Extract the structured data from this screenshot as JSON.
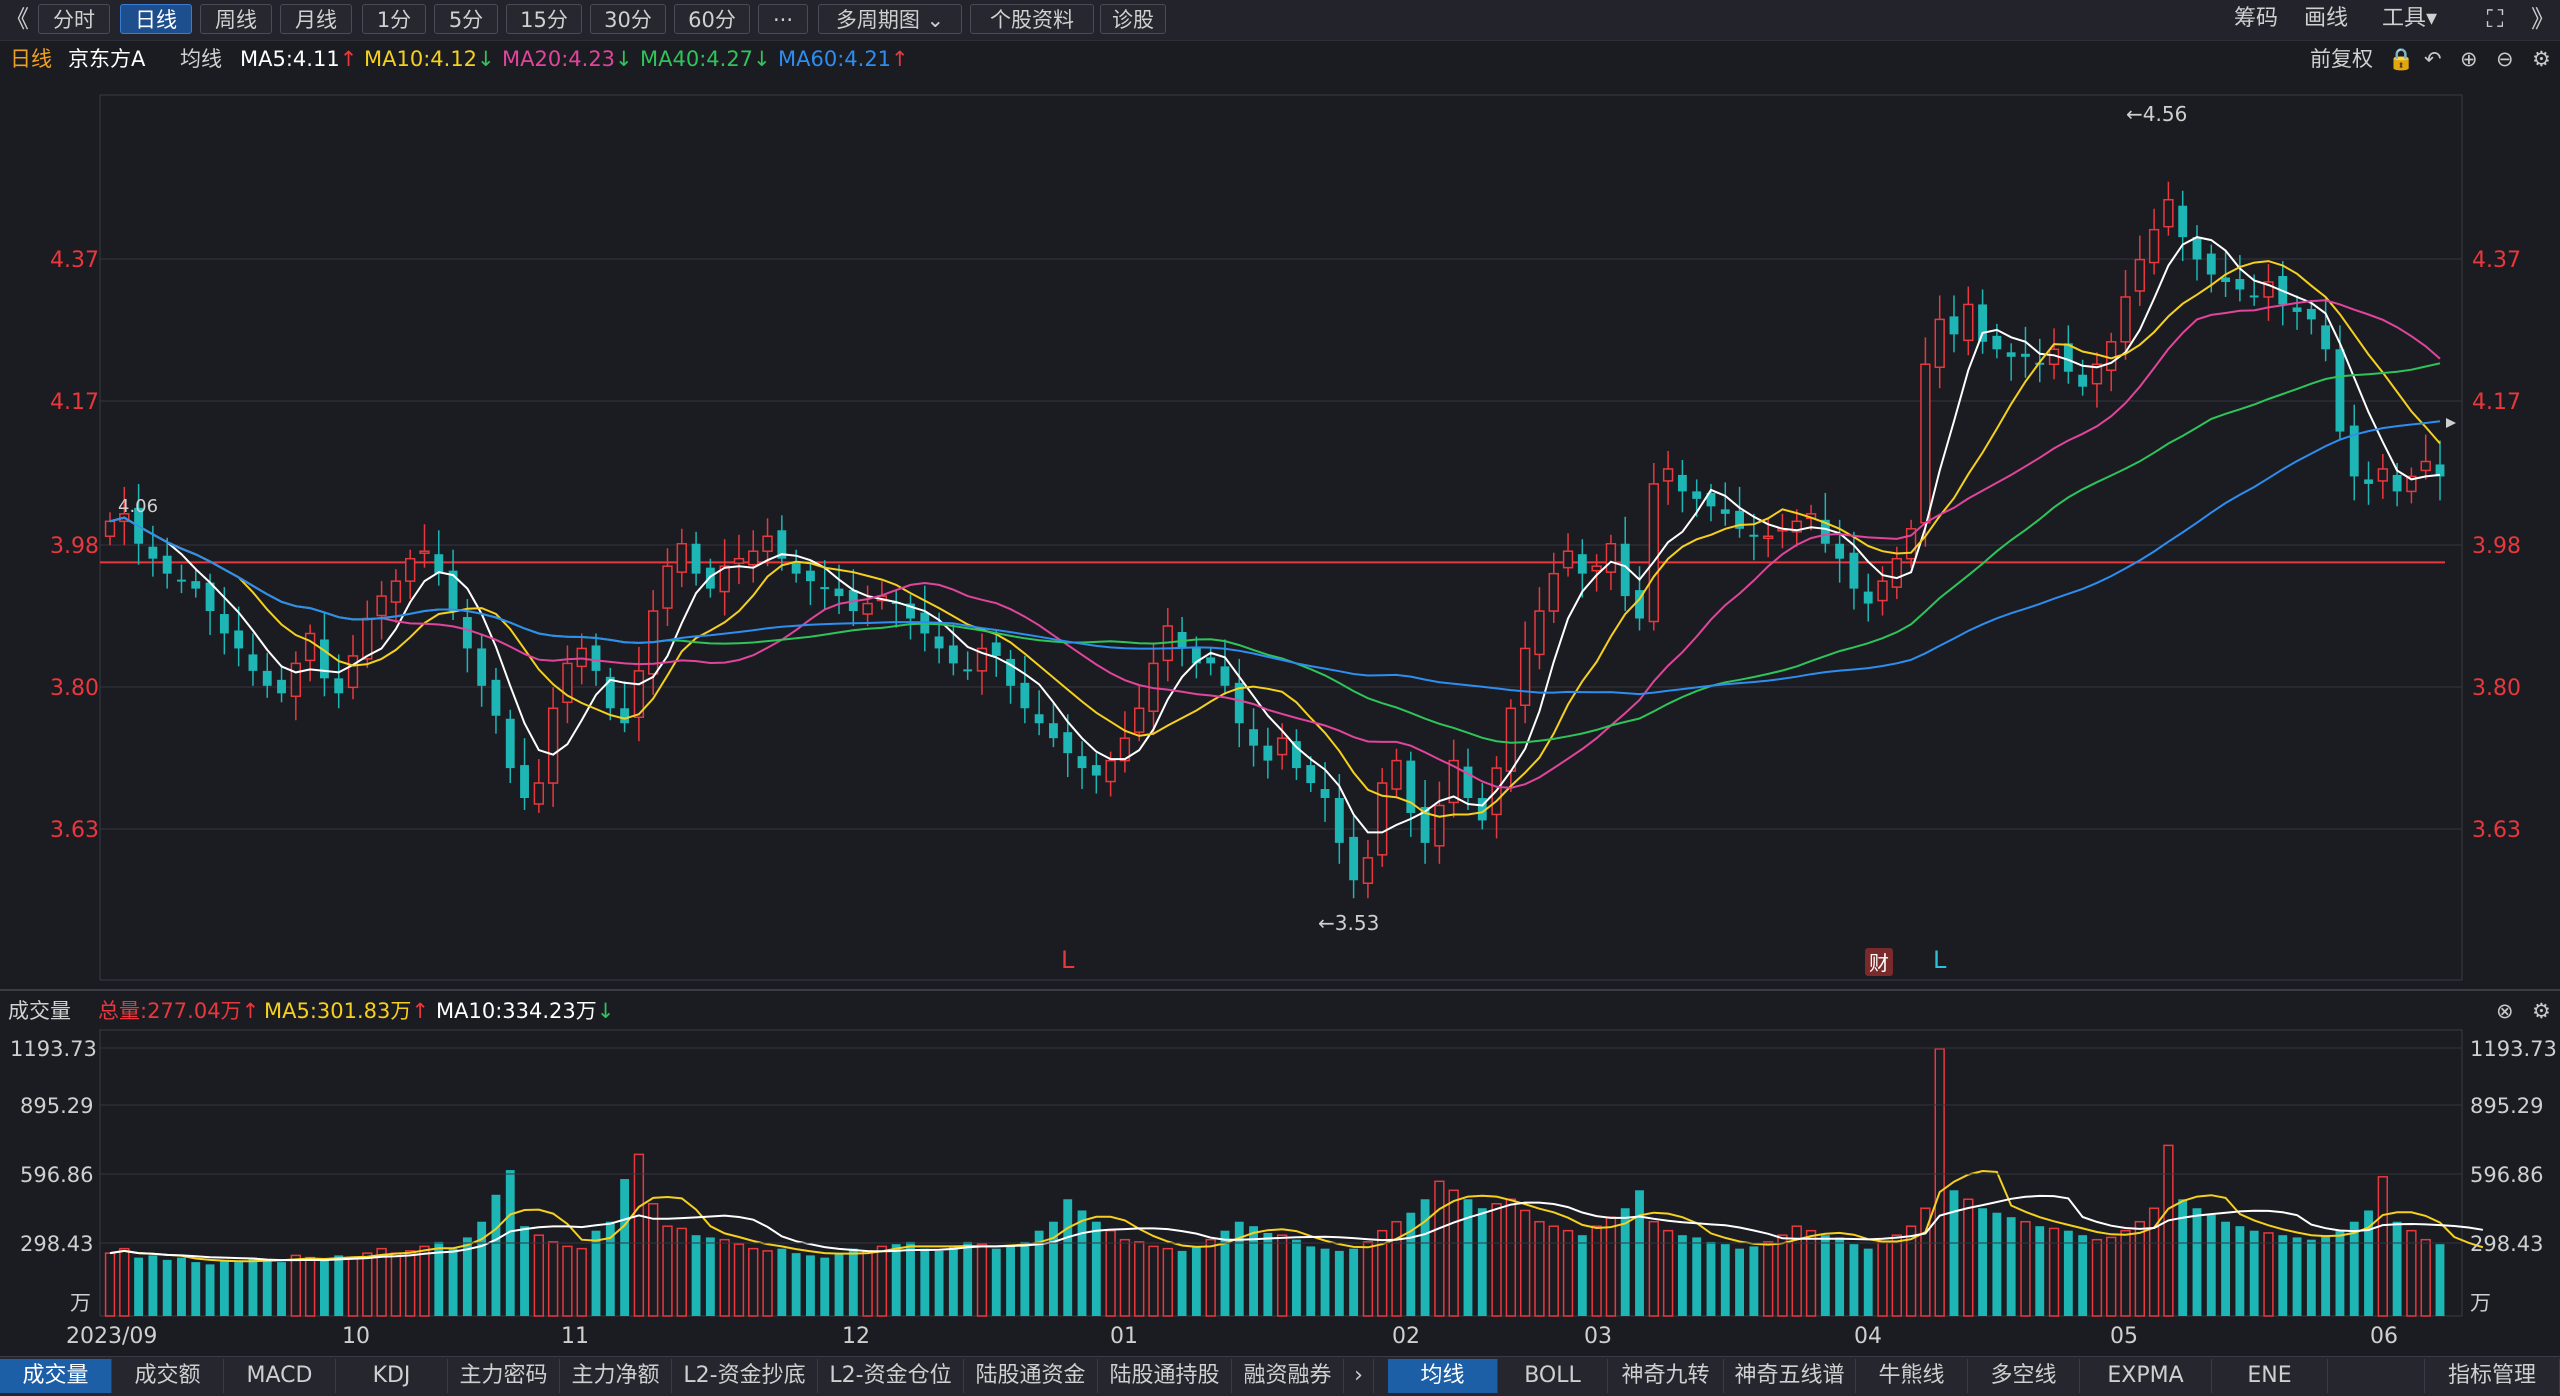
{
  "toolbar": {
    "back_glyph": "《",
    "tabs": [
      "分时",
      "日线",
      "周线",
      "月线",
      "1分",
      "5分",
      "15分",
      "30分",
      "60分",
      "···",
      "多周期图 ⌄",
      "个股资料",
      "诊股"
    ],
    "active_tab": "日线",
    "right_items": [
      "筹码",
      "画线",
      "工具▾"
    ],
    "fullscreen_glyph": "⛶",
    "more_glyph": "》"
  },
  "info": {
    "period": "日线",
    "stock": "京东方A",
    "line_type": "均线",
    "ma5": "MA5:4.11",
    "ma10": "MA10:4.12",
    "ma20": "MA20:4.23",
    "ma40": "MA40:4.27",
    "ma60": "MA60:4.21",
    "ma5_dir": "↑",
    "ma10_dir": "↓",
    "ma20_dir": "↓",
    "ma40_dir": "↓",
    "ma60_dir": "↑",
    "adjust": "前复权"
  },
  "price_axis": [
    "4.37",
    "4.17",
    "3.98",
    "3.80",
    "3.63"
  ],
  "annotations": {
    "high": "←4.56",
    "low": "←3.53",
    "early_label": "4.06",
    "marker_l1": "L",
    "marker_cai": "财",
    "marker_l2": "L"
  },
  "volume": {
    "title": "成交量",
    "total": "总量:277.04万",
    "ma5": "MA5:301.83万",
    "ma10": "MA10:334.23万",
    "total_dir": "↑",
    "ma5_dir": "↑",
    "ma10_dir": "↓",
    "axis": [
      "1193.73",
      "895.29",
      "596.86",
      "298.43",
      "万"
    ]
  },
  "x_axis": [
    "2023/09",
    "10",
    "11",
    "12",
    "01",
    "02",
    "03",
    "04",
    "05",
    "06"
  ],
  "bottom_tabs_left": [
    "成交量",
    "成交额",
    "MACD",
    "KDJ",
    "主力密码",
    "主力净额",
    "L2-资金抄底",
    "L2-资金仓位",
    "陆股通资金",
    "陆股通持股",
    "融资融券"
  ],
  "bottom_tabs_right": [
    "均线",
    "BOLL",
    "神奇九转",
    "神奇五线谱",
    "牛熊线",
    "多空线",
    "EXPMA",
    "ENE"
  ],
  "bottom_manage": "指标管理",
  "colors": {
    "up": "#e8383d",
    "down": "#1eb5b5",
    "ma5": "#ffffff",
    "ma10": "#f5d01f",
    "ma20": "#e0459c",
    "ma40": "#2fc45a",
    "ma60": "#2d8ef0",
    "axis_text": "#e8383d"
  },
  "chart_data": {
    "type": "candlestick",
    "price_range": [
      3.45,
      4.6
    ],
    "support_line": 3.995,
    "volume_range": [
      0,
      1193.73
    ],
    "months": [
      "2023/09",
      "10",
      "11",
      "12",
      "01",
      "02",
      "03",
      "04",
      "05",
      "06"
    ],
    "closes": [
      4.05,
      4.06,
      4.02,
      4.0,
      3.98,
      3.97,
      3.96,
      3.93,
      3.9,
      3.88,
      3.85,
      3.83,
      3.82,
      3.86,
      3.9,
      3.84,
      3.82,
      3.87,
      3.92,
      3.95,
      3.97,
      4.0,
      4.01,
      3.98,
      3.93,
      3.88,
      3.83,
      3.79,
      3.72,
      3.68,
      3.7,
      3.8,
      3.86,
      3.88,
      3.85,
      3.8,
      3.78,
      3.85,
      3.93,
      3.99,
      4.02,
      3.98,
      3.96,
      3.99,
      4.0,
      4.01,
      4.03,
      4.0,
      3.98,
      3.97,
      3.96,
      3.95,
      3.93,
      3.94,
      3.95,
      3.94,
      3.92,
      3.9,
      3.88,
      3.86,
      3.85,
      3.88,
      3.87,
      3.83,
      3.8,
      3.78,
      3.76,
      3.74,
      3.72,
      3.71,
      3.73,
      3.76,
      3.8,
      3.86,
      3.91,
      3.88,
      3.86,
      3.86,
      3.83,
      3.78,
      3.75,
      3.73,
      3.76,
      3.72,
      3.7,
      3.68,
      3.62,
      3.57,
      3.6,
      3.7,
      3.73,
      3.66,
      3.62,
      3.67,
      3.73,
      3.68,
      3.65,
      3.72,
      3.8,
      3.88,
      3.93,
      3.98,
      4.01,
      3.98,
      3.99,
      4.02,
      3.95,
      3.92,
      4.1,
      4.12,
      4.09,
      4.08,
      4.07,
      4.06,
      4.04,
      4.03,
      4.03,
      4.04,
      4.05,
      4.06,
      4.02,
      4.0,
      3.96,
      3.94,
      3.97,
      4.0,
      4.04,
      4.26,
      4.32,
      4.3,
      4.34,
      4.29,
      4.28,
      4.27,
      4.27,
      4.26,
      4.28,
      4.25,
      4.23,
      4.26,
      4.29,
      4.35,
      4.4,
      4.44,
      4.48,
      4.43,
      4.4,
      4.38,
      4.37,
      4.36,
      4.35,
      4.37,
      4.34,
      4.33,
      4.32,
      4.28,
      4.17,
      4.11,
      4.1,
      4.12,
      4.09,
      4.11,
      4.13,
      4.11
    ],
    "volumes": [
      280,
      300,
      260,
      270,
      250,
      260,
      240,
      230,
      250,
      240,
      260,
      250,
      240,
      270,
      260,
      250,
      270,
      260,
      280,
      300,
      280,
      290,
      310,
      330,
      300,
      350,
      420,
      540,
      650,
      400,
      360,
      330,
      310,
      300,
      380,
      420,
      610,
      720,
      500,
      400,
      390,
      360,
      350,
      340,
      320,
      300,
      290,
      300,
      280,
      270,
      260,
      280,
      300,
      290,
      310,
      320,
      330,
      300,
      290,
      310,
      330,
      320,
      300,
      310,
      330,
      380,
      420,
      520,
      470,
      420,
      380,
      340,
      330,
      310,
      300,
      290,
      310,
      340,
      380,
      420,
      400,
      370,
      360,
      340,
      310,
      300,
      290,
      300,
      330,
      380,
      420,
      460,
      520,
      600,
      560,
      520,
      480,
      500,
      520,
      470,
      420,
      400,
      380,
      360,
      400,
      440,
      480,
      560,
      420,
      380,
      360,
      350,
      330,
      320,
      300,
      310,
      330,
      360,
      400,
      380,
      360,
      350,
      320,
      300,
      330,
      360,
      400,
      480,
      1190,
      560,
      520,
      480,
      460,
      440,
      420,
      400,
      390,
      380,
      360,
      340,
      350,
      380,
      420,
      480,
      760,
      520,
      480,
      450,
      420,
      400,
      380,
      370,
      360,
      350,
      340,
      360,
      380,
      420,
      470,
      620,
      420,
      380,
      340,
      320,
      300,
      290,
      280
    ]
  }
}
